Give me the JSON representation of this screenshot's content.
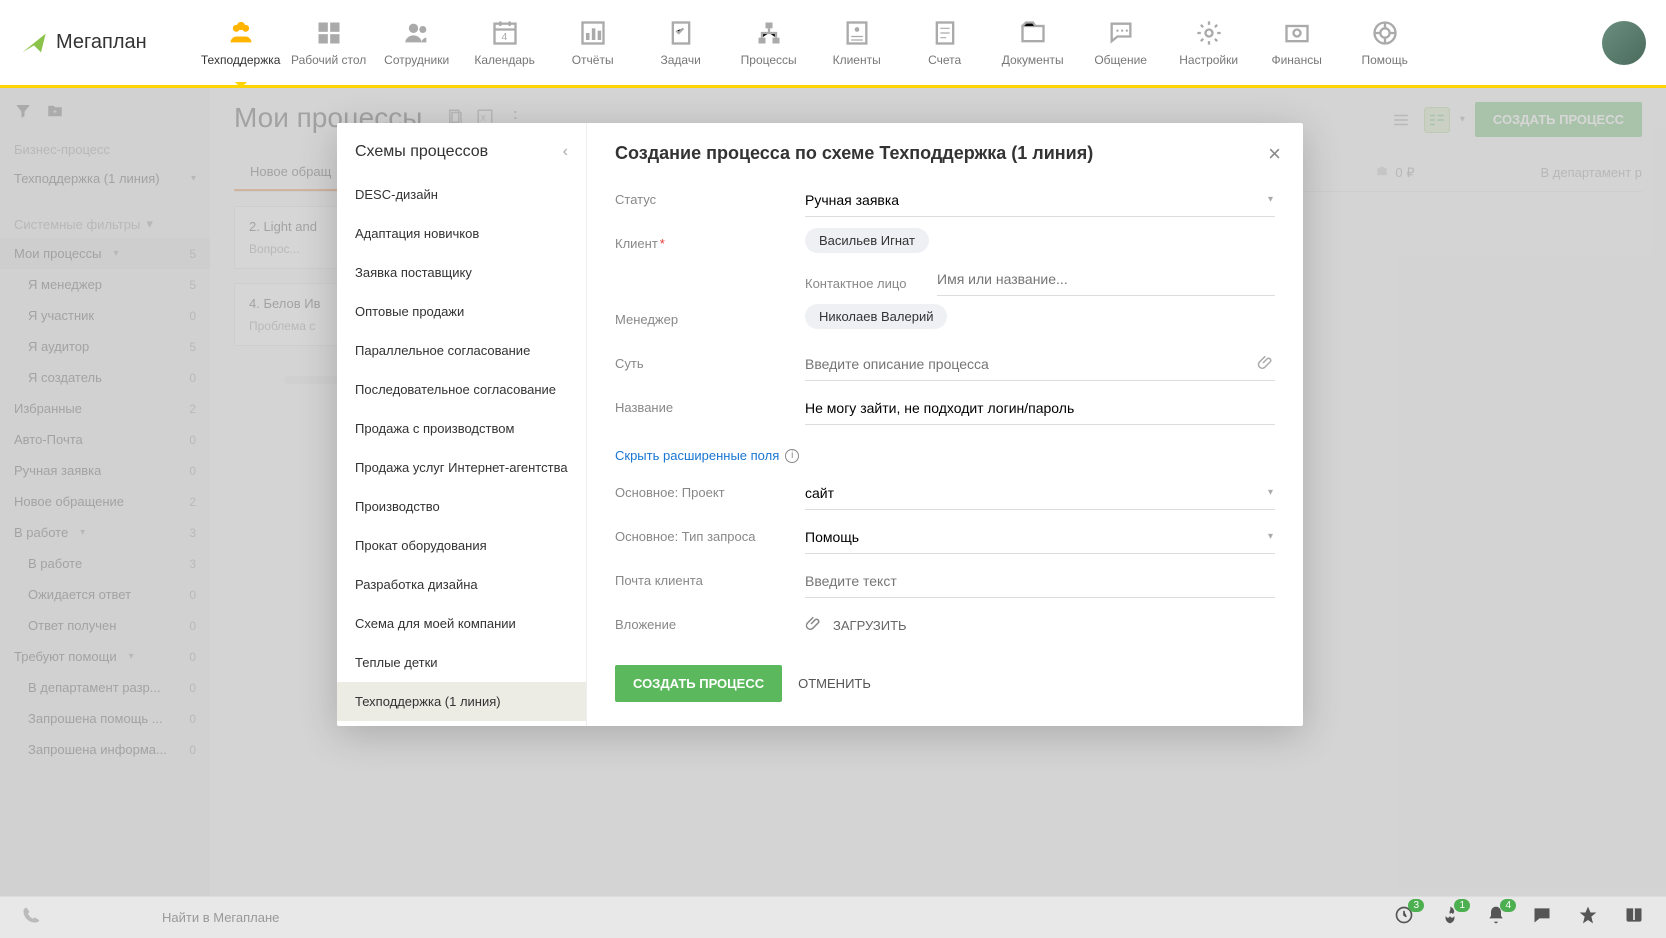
{
  "logo_text": "Мегаплан",
  "topnav": [
    {
      "id": "support",
      "label": "Техподдержка",
      "active": true
    },
    {
      "id": "desktop",
      "label": "Рабочий стол"
    },
    {
      "id": "staff",
      "label": "Сотрудники"
    },
    {
      "id": "calendar",
      "label": "Календарь"
    },
    {
      "id": "reports",
      "label": "Отчёты"
    },
    {
      "id": "tasks",
      "label": "Задачи"
    },
    {
      "id": "processes",
      "label": "Процессы"
    },
    {
      "id": "clients",
      "label": "Клиенты"
    },
    {
      "id": "accounts",
      "label": "Счета"
    },
    {
      "id": "documents",
      "label": "Документы"
    },
    {
      "id": "chat",
      "label": "Общение"
    },
    {
      "id": "settings",
      "label": "Настройки"
    },
    {
      "id": "finance",
      "label": "Финансы"
    },
    {
      "id": "help",
      "label": "Помощь"
    }
  ],
  "sidebar": {
    "section_label": "Бизнес-процесс",
    "current_process": "Техподдержка (1 линия)",
    "sysfilters_label": "Системные фильтры",
    "items": [
      {
        "label": "Мои процессы",
        "count": "5",
        "selected": true,
        "expandable": true
      },
      {
        "label": "Я менеджер",
        "count": "5",
        "sub": true
      },
      {
        "label": "Я участник",
        "count": "0",
        "sub": true
      },
      {
        "label": "Я аудитор",
        "count": "5",
        "sub": true
      },
      {
        "label": "Я создатель",
        "count": "0",
        "sub": true
      },
      {
        "label": "Избранные",
        "count": "2"
      },
      {
        "label": "Авто-Почта",
        "count": "0"
      },
      {
        "label": "Ручная заявка",
        "count": "0"
      },
      {
        "label": "Новое обращение",
        "count": "2"
      },
      {
        "label": "В работе",
        "count": "3",
        "expandable": true
      },
      {
        "label": "В работе",
        "count": "3",
        "sub": true
      },
      {
        "label": "Ожидается ответ",
        "count": "0",
        "sub": true
      },
      {
        "label": "Ответ получен",
        "count": "0",
        "sub": true
      },
      {
        "label": "Требуют помощи",
        "count": "0",
        "expandable": true
      },
      {
        "label": "В департамент разр...",
        "count": "0",
        "sub": true
      },
      {
        "label": "Запрошена помощь ...",
        "count": "0",
        "sub": true
      },
      {
        "label": "Запрошена информа...",
        "count": "0",
        "sub": true
      }
    ]
  },
  "page_title": "Мои процессы",
  "toolbar": {
    "create_label": "СОЗДАТЬ ПРОЦЕСС"
  },
  "tabs": {
    "left": "Новое обращ",
    "right_amount": "0 ₽",
    "right_dept": "В департамент р"
  },
  "cards": [
    {
      "title": "2. Light and",
      "sub": "Вопрос..."
    },
    {
      "title": "4. Белов Ив",
      "sub": "Проблема с"
    }
  ],
  "modal": {
    "left": {
      "title": "Схемы процессов",
      "schemes": [
        "DESC-дизайн",
        "Адаптация новичков",
        "Заявка поставщику",
        "Оптовые продажи",
        "Параллельное согласование",
        "Последовательное согласование",
        "Продажа с производством",
        "Продажа услуг Интернет-агентства",
        "Производство",
        "Прокат оборудования",
        "Разработка дизайна",
        "Схема для моей компании",
        "Теплые детки",
        "Техподдержка (1 линия)"
      ],
      "selected_index": 13
    },
    "right": {
      "title": "Создание процесса по схеме Техподдержка (1 линия)",
      "labels": {
        "status": "Статус",
        "client": "Клиент",
        "contact": "Контактное лицо",
        "manager": "Менеджер",
        "essence": "Суть",
        "name": "Название",
        "project": "Основное: Проект",
        "reqtype": "Основное: Тип запроса",
        "email": "Почта клиента",
        "attachment": "Вложение"
      },
      "values": {
        "status": "Ручная заявка",
        "client": "Васильев Игнат",
        "contact_placeholder": "Имя или название...",
        "manager": "Николаев Валерий",
        "essence_placeholder": "Введите описание процесса",
        "name": "Не могу зайти, не подходит логин/пароль",
        "project": "сайт",
        "reqtype": "Помощь",
        "email_placeholder": "Введите текст",
        "upload": "ЗАГРУЗИТЬ"
      },
      "toggle_link": "Скрыть расширенные поля",
      "submit": "СОЗДАТЬ ПРОЦЕСС",
      "cancel": "ОТМЕНИТЬ"
    }
  },
  "bottombar": {
    "search_placeholder": "Найти в Мегаплане",
    "badges": {
      "clock": "3",
      "fire": "1",
      "bell": "4"
    }
  }
}
